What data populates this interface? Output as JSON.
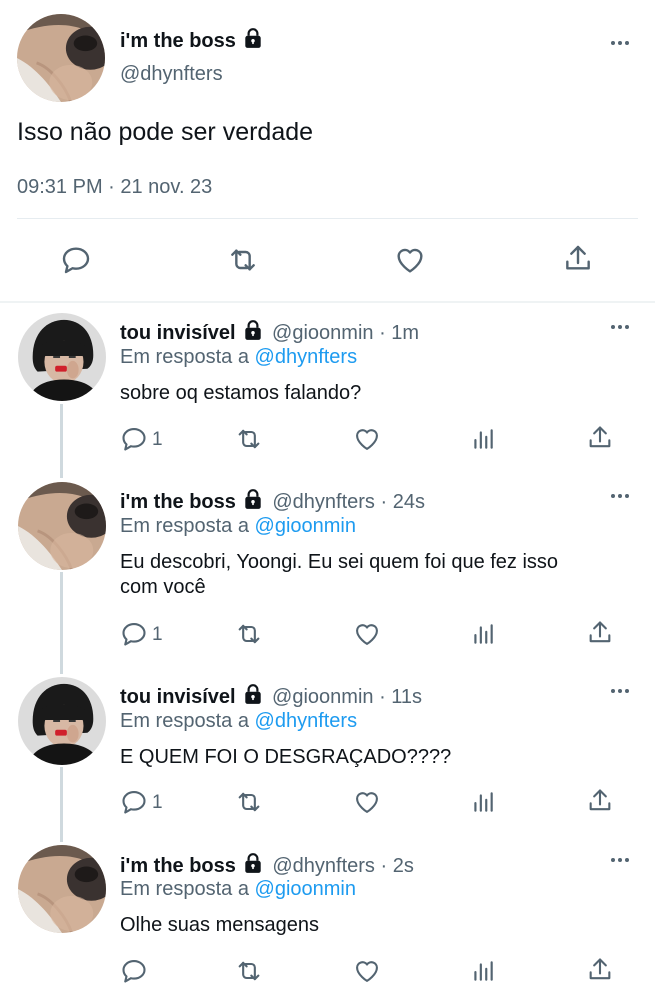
{
  "main_tweet": {
    "author_name": "i'm the boss",
    "handle": "@dhynfters",
    "text": "Isso não pode ser verdade",
    "timestamp": "09:31 PM · 21 nov. 23",
    "actions": [
      "reply-icon",
      "retweet-icon",
      "like-icon",
      "share-icon"
    ]
  },
  "replies": [
    {
      "author_name": "tou invisível",
      "handle": "@gioonmin",
      "time": "1m",
      "reply_prefix": "Em resposta a",
      "reply_to": "@dhynfters",
      "text": "sobre oq estamos falando?",
      "reply_count": "1"
    },
    {
      "author_name": "i'm the boss",
      "handle": "@dhynfters",
      "time": "24s",
      "reply_prefix": "Em resposta a",
      "reply_to": "@gioonmin",
      "text_line1": "Eu descobri, Yoongi. Eu sei quem foi que fez isso",
      "text_line2": "com você",
      "reply_count": "1"
    },
    {
      "author_name": "tou invisível",
      "handle": "@gioonmin",
      "time": "11s",
      "reply_prefix": "Em resposta a",
      "reply_to": "@dhynfters",
      "text": "E QUEM FOI O DESGRAÇADO????",
      "reply_count": "1"
    },
    {
      "author_name": "i'm the boss",
      "handle": "@dhynfters",
      "time": "2s",
      "reply_prefix": "Em resposta a",
      "reply_to": "@gioonmin",
      "text": "Olhe suas mensagens",
      "reply_count": ""
    }
  ],
  "colors": {
    "text": "#0f1419",
    "secondary": "#536471",
    "link": "#1d9bf0",
    "divider": "#e6ecf0"
  }
}
